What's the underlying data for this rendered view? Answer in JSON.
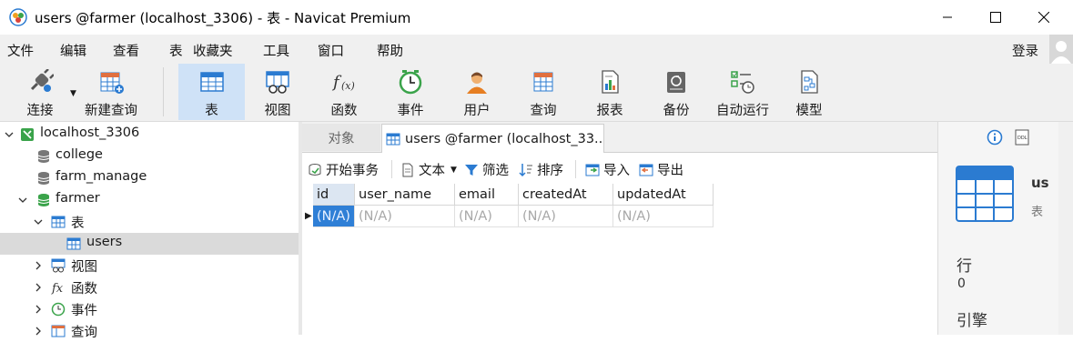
{
  "window": {
    "title": "users @farmer (localhost_3306) - 表 - Navicat Premium"
  },
  "menu": [
    "文件",
    "编辑",
    "查看",
    "表",
    "收藏夹",
    "工具",
    "窗口",
    "帮助"
  ],
  "login_label": "登录",
  "toolbar": [
    {
      "label": "连接",
      "icon": "plug-icon"
    },
    {
      "label": "新建查询",
      "icon": "new-query-icon"
    },
    {
      "label": "表",
      "icon": "table-icon",
      "active": true
    },
    {
      "label": "视图",
      "icon": "view-icon"
    },
    {
      "label": "函数",
      "icon": "function-icon"
    },
    {
      "label": "事件",
      "icon": "clock-icon"
    },
    {
      "label": "用户",
      "icon": "user-icon"
    },
    {
      "label": "查询",
      "icon": "query-icon"
    },
    {
      "label": "报表",
      "icon": "report-icon"
    },
    {
      "label": "备份",
      "icon": "backup-icon"
    },
    {
      "label": "自动运行",
      "icon": "auto-run-icon"
    },
    {
      "label": "模型",
      "icon": "model-icon"
    }
  ],
  "tree": {
    "connection": "localhost_3306",
    "databases": [
      "college",
      "farm_manage",
      "farmer"
    ],
    "farmer_children": {
      "tables_label": "表",
      "table_users": "users",
      "views_label": "视图",
      "functions_label": "函数",
      "events_label": "事件",
      "queries_label": "查询"
    }
  },
  "tabs": {
    "objects": "对象",
    "users": "users @farmer (localhost_33..."
  },
  "subtoolbar": {
    "begin_tx": "开始事务",
    "text": "文本",
    "filter": "筛选",
    "sort": "排序",
    "import": "导入",
    "export": "导出"
  },
  "grid": {
    "columns": [
      "id",
      "user_name",
      "email",
      "createdAt",
      "updatedAt"
    ],
    "row": [
      "(N/A)",
      "(N/A)",
      "(N/A)",
      "(N/A)",
      "(N/A)"
    ]
  },
  "info_panel": {
    "name_partial": "us",
    "type_partial": "表",
    "rows_label": "行",
    "rows_value": "0",
    "engine_label": "引擎"
  },
  "colors": {
    "accent_blue": "#2b7bd1",
    "toolbar_active": "#cfe2f7",
    "selected_cell": "#2f7fd6"
  }
}
